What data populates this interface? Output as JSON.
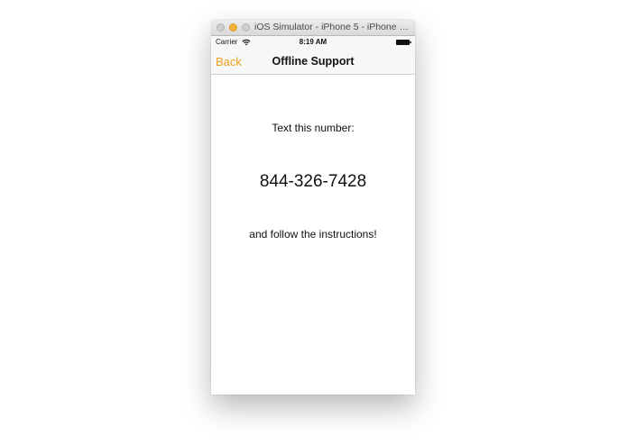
{
  "window": {
    "title": "iOS Simulator - iPhone 5 - iPhone 5 /..."
  },
  "status_bar": {
    "carrier": "Carrier",
    "time": "8:19 AM"
  },
  "nav_bar": {
    "back_label": "Back",
    "title": "Offline Support"
  },
  "content": {
    "instruction_top": "Text this number:",
    "phone_number": "844-326-7428",
    "instruction_bottom": "and follow the instructions!"
  },
  "colors": {
    "accent": "#f0a020",
    "minimize_button": "#f3b33a"
  },
  "icons": [
    "wifi-icon",
    "battery-icon"
  ]
}
